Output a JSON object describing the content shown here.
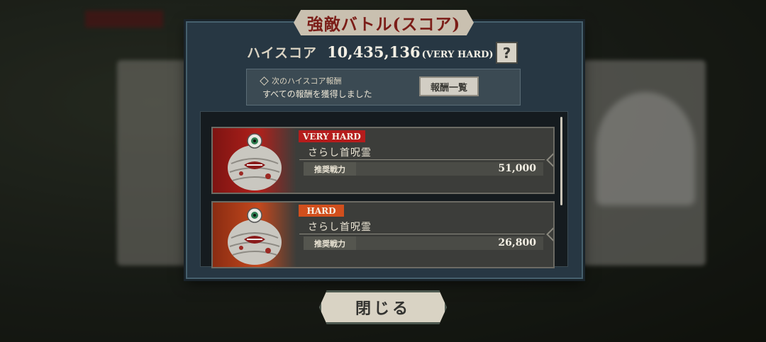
{
  "title": "強敵バトル(スコア)",
  "high_score": {
    "label": "ハイスコア",
    "value": "10,435,136",
    "difficulty": "(VERY HARD)",
    "help_icon": "question-icon",
    "help_glyph": "?"
  },
  "next_reward": {
    "heading": "次のハイスコア報酬",
    "message": "すべての報酬を獲得しました",
    "button_label": "報酬一覧"
  },
  "enemies": [
    {
      "difficulty": "VERY HARD",
      "name": "さらし首呪霊",
      "power_label": "推奨戦力",
      "power_value": "51,000"
    },
    {
      "difficulty": "HARD",
      "name": "さらし首呪霊",
      "power_label": "推奨戦力",
      "power_value": "26,800"
    }
  ],
  "close_label": "閉じる",
  "colors": {
    "panel": "#273743",
    "title_text": "#7b1d18",
    "very_hard": "#b51c1c",
    "hard": "#d14f1d"
  }
}
